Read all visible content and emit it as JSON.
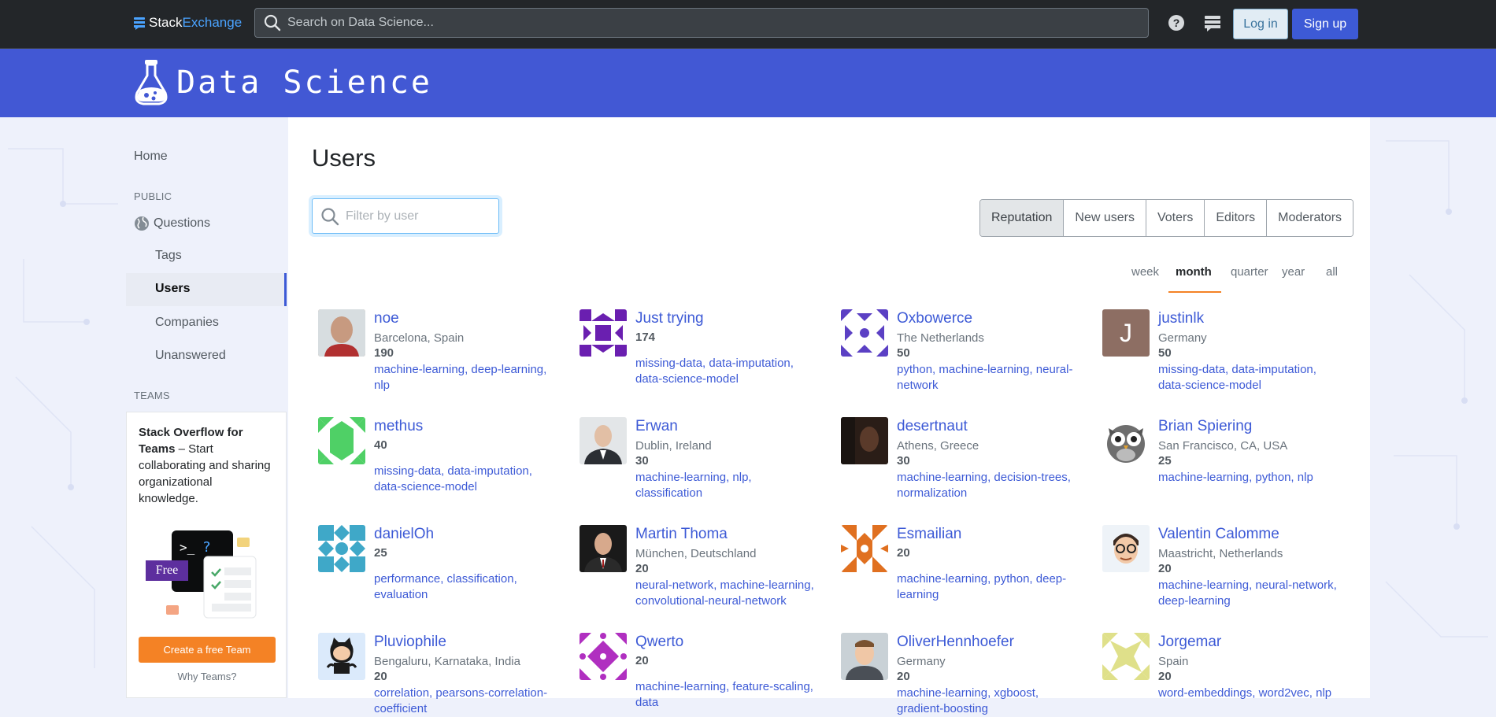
{
  "topbar": {
    "logo_part1": "Stack",
    "logo_part2": "Exchange",
    "search_placeholder": "Search on Data Science...",
    "login_label": "Log in",
    "signup_label": "Sign up",
    "icons": [
      "stackexchange-icon",
      "search-icon",
      "help-icon",
      "site-switcher-icon"
    ]
  },
  "site": {
    "title": "Data Science"
  },
  "nav": {
    "home": "Home",
    "public_label": "PUBLIC",
    "questions": "Questions",
    "tags": "Tags",
    "users": "Users",
    "companies": "Companies",
    "unanswered": "Unanswered",
    "teams_label": "TEAMS",
    "teams_title": "Stack Overflow for Teams",
    "teams_desc": " – Start collaborating and sharing organizational knowledge.",
    "free_badge": "Free",
    "create_team": "Create a free Team",
    "why_teams": "Why Teams?"
  },
  "main": {
    "title": "Users",
    "filter_placeholder": "Filter by user",
    "tabs": [
      "Reputation",
      "New users",
      "Voters",
      "Editors",
      "Moderators"
    ],
    "active_tab": "Reputation",
    "periods": [
      "week",
      "month",
      "quarter",
      "year",
      "all"
    ],
    "active_period": "month"
  },
  "users": [
    {
      "name": "noe",
      "location": "Barcelona, Spain",
      "rep": "190",
      "tags": "machine-learning, deep-learning, nlp"
    },
    {
      "name": "Just trying",
      "location": "",
      "rep": "174",
      "tags": "missing-data, data-imputation, data-science-model"
    },
    {
      "name": "Oxbowerce",
      "location": "The Netherlands",
      "rep": "50",
      "tags": "python, machine-learning, neural-network"
    },
    {
      "name": "justinlk",
      "location": "Germany",
      "rep": "50",
      "tags": "missing-data, data-imputation, data-science-model"
    },
    {
      "name": "methus",
      "location": "",
      "rep": "40",
      "tags": "missing-data, data-imputation, data-science-model"
    },
    {
      "name": "Erwan",
      "location": "Dublin, Ireland",
      "rep": "30",
      "tags": "machine-learning, nlp, classification"
    },
    {
      "name": "desertnaut",
      "location": "Athens, Greece",
      "rep": "30",
      "tags": "machine-learning, decision-trees, normalization"
    },
    {
      "name": "Brian Spiering",
      "location": "San Francisco, CA, USA",
      "rep": "25",
      "tags": "machine-learning, python, nlp"
    },
    {
      "name": "danielOh",
      "location": "",
      "rep": "25",
      "tags": "performance, classification, evaluation"
    },
    {
      "name": "Martin Thoma",
      "location": "München, Deutschland",
      "rep": "20",
      "tags": "neural-network, machine-learning, convolutional-neural-network"
    },
    {
      "name": "Esmailian",
      "location": "",
      "rep": "20",
      "tags": "machine-learning, python, deep-learning"
    },
    {
      "name": "Valentin Calomme",
      "location": "Maastricht, Netherlands",
      "rep": "20",
      "tags": "machine-learning, neural-network, deep-learning"
    },
    {
      "name": "Pluviophile",
      "location": "Bengaluru, Karnataka, India",
      "rep": "20",
      "tags": "correlation, pearsons-correlation-coefficient"
    },
    {
      "name": "Qwerto",
      "location": "",
      "rep": "20",
      "tags": "machine-learning, feature-scaling, data"
    },
    {
      "name": "OliverHennhoefer",
      "location": "Germany",
      "rep": "20",
      "tags": "machine-learning, xgboost, gradient-boosting"
    },
    {
      "name": "Jorgemar",
      "location": "Spain",
      "rep": "20",
      "tags": "word-embeddings, word2vec, nlp"
    }
  ],
  "avatar_letter": "J",
  "colors": {
    "accent": "#3d5ad6",
    "header": "#4258d4",
    "topbar": "#232629",
    "orange": "#f48225"
  }
}
